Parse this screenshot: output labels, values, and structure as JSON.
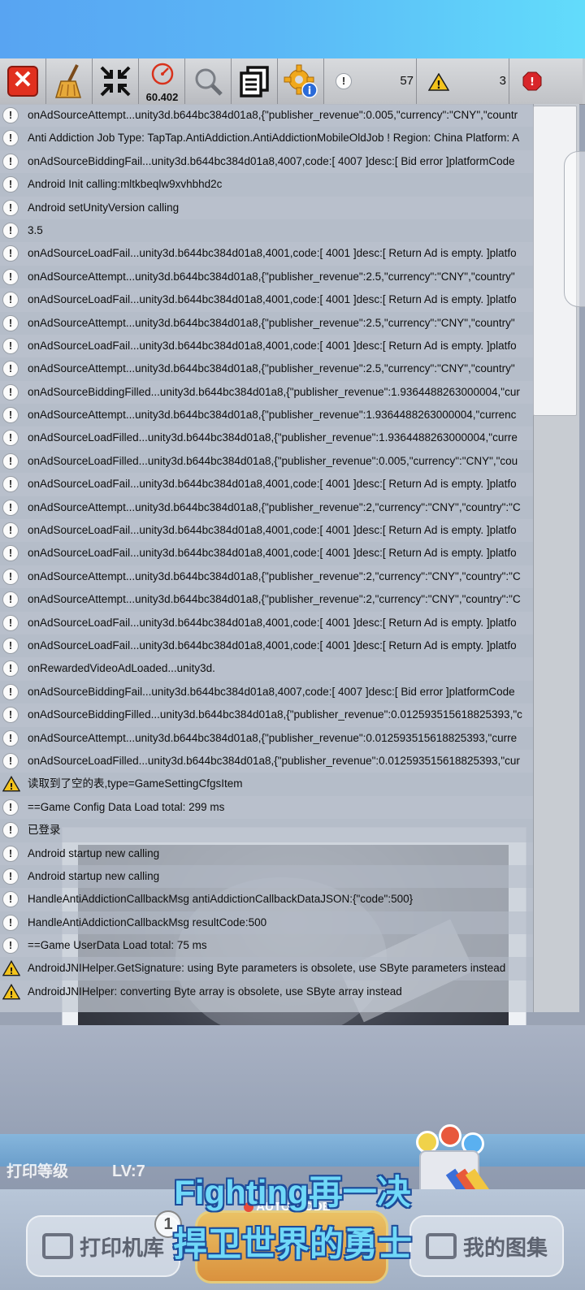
{
  "toolbar": {
    "fps": "60.402",
    "info_count": "57",
    "warning_count": "3"
  },
  "log_entries": [
    {
      "level": "info",
      "text": "onAdSourceAttempt...unity3d.b644bc384d01a8,{\"publisher_revenue\":0.005,\"currency\":\"CNY\",\"countr"
    },
    {
      "level": "info",
      "text": "Anti Addiction Job Type: TapTap.AntiAddiction.AntiAddictionMobileOldJob ! Region: China Platform: A"
    },
    {
      "level": "info",
      "text": "onAdSourceBiddingFail...unity3d.b644bc384d01a8,4007,code:[ 4007 ]desc:[ Bid error ]platformCode"
    },
    {
      "level": "info",
      "text": "Android Init calling:mltkbeqlw9xvhbhd2c"
    },
    {
      "level": "info",
      "text": "Android setUnityVersion calling"
    },
    {
      "level": "info",
      "text": "3.5"
    },
    {
      "level": "info",
      "text": "onAdSourceLoadFail...unity3d.b644bc384d01a8,4001,code:[ 4001 ]desc:[ Return Ad is empty. ]platfo"
    },
    {
      "level": "info",
      "text": "onAdSourceAttempt...unity3d.b644bc384d01a8,{\"publisher_revenue\":2.5,\"currency\":\"CNY\",\"country\""
    },
    {
      "level": "info",
      "text": "onAdSourceLoadFail...unity3d.b644bc384d01a8,4001,code:[ 4001 ]desc:[ Return Ad is empty. ]platfo"
    },
    {
      "level": "info",
      "text": "onAdSourceAttempt...unity3d.b644bc384d01a8,{\"publisher_revenue\":2.5,\"currency\":\"CNY\",\"country\""
    },
    {
      "level": "info",
      "text": "onAdSourceLoadFail...unity3d.b644bc384d01a8,4001,code:[ 4001 ]desc:[ Return Ad is empty. ]platfo"
    },
    {
      "level": "info",
      "text": "onAdSourceAttempt...unity3d.b644bc384d01a8,{\"publisher_revenue\":2.5,\"currency\":\"CNY\",\"country\""
    },
    {
      "level": "info",
      "text": "onAdSourceBiddingFilled...unity3d.b644bc384d01a8,{\"publisher_revenue\":1.9364488263000004,\"cur"
    },
    {
      "level": "info",
      "text": "onAdSourceAttempt...unity3d.b644bc384d01a8,{\"publisher_revenue\":1.9364488263000004,\"currenc"
    },
    {
      "level": "info",
      "text": "onAdSourceLoadFilled...unity3d.b644bc384d01a8,{\"publisher_revenue\":1.9364488263000004,\"curre"
    },
    {
      "level": "info",
      "text": "onAdSourceLoadFilled...unity3d.b644bc384d01a8,{\"publisher_revenue\":0.005,\"currency\":\"CNY\",\"cou"
    },
    {
      "level": "info",
      "text": "onAdSourceLoadFail...unity3d.b644bc384d01a8,4001,code:[ 4001 ]desc:[ Return Ad is empty. ]platfo"
    },
    {
      "level": "info",
      "text": "onAdSourceAttempt...unity3d.b644bc384d01a8,{\"publisher_revenue\":2,\"currency\":\"CNY\",\"country\":\"C"
    },
    {
      "level": "info",
      "text": "onAdSourceLoadFail...unity3d.b644bc384d01a8,4001,code:[ 4001 ]desc:[ Return Ad is empty. ]platfo"
    },
    {
      "level": "info",
      "text": "onAdSourceLoadFail...unity3d.b644bc384d01a8,4001,code:[ 4001 ]desc:[ Return Ad is empty. ]platfo"
    },
    {
      "level": "info",
      "text": "onAdSourceAttempt...unity3d.b644bc384d01a8,{\"publisher_revenue\":2,\"currency\":\"CNY\",\"country\":\"C"
    },
    {
      "level": "info",
      "text": "onAdSourceAttempt...unity3d.b644bc384d01a8,{\"publisher_revenue\":2,\"currency\":\"CNY\",\"country\":\"C"
    },
    {
      "level": "info",
      "text": "onAdSourceLoadFail...unity3d.b644bc384d01a8,4001,code:[ 4001 ]desc:[ Return Ad is empty. ]platfo"
    },
    {
      "level": "info",
      "text": "onAdSourceLoadFail...unity3d.b644bc384d01a8,4001,code:[ 4001 ]desc:[ Return Ad is empty. ]platfo"
    },
    {
      "level": "info",
      "text": "onRewardedVideoAdLoaded...unity3d."
    },
    {
      "level": "info",
      "text": "onAdSourceBiddingFail...unity3d.b644bc384d01a8,4007,code:[ 4007 ]desc:[ Bid error ]platformCode"
    },
    {
      "level": "info",
      "text": "onAdSourceBiddingFilled...unity3d.b644bc384d01a8,{\"publisher_revenue\":0.012593515618825393,\"c"
    },
    {
      "level": "info",
      "text": "onAdSourceAttempt...unity3d.b644bc384d01a8,{\"publisher_revenue\":0.012593515618825393,\"curre"
    },
    {
      "level": "info",
      "text": "onAdSourceLoadFilled...unity3d.b644bc384d01a8,{\"publisher_revenue\":0.012593515618825393,\"cur"
    },
    {
      "level": "warning",
      "text": "读取到了空的表,type=GameSettingCfgsItem"
    },
    {
      "level": "info",
      "text": "==Game Config Data Load total: 299 ms"
    },
    {
      "level": "info",
      "text": "已登录"
    },
    {
      "level": "info",
      "text": "Android startup new calling"
    },
    {
      "level": "info",
      "text": "Android startup new calling"
    },
    {
      "level": "info",
      "text": "HandleAntiAddictionCallbackMsg antiAddictionCallbackDataJSON:{\"code\":500}"
    },
    {
      "level": "info",
      "text": "HandleAntiAddictionCallbackMsg resultCode:500"
    },
    {
      "level": "info",
      "text": "==Game UserData Load total: 75 ms"
    },
    {
      "level": "warning",
      "text": "AndroidJNIHelper.GetSignature: using Byte parameters is obsolete, use SByte parameters instead"
    },
    {
      "level": "warning",
      "text": "AndroidJNIHelper: converting Byte array is obsolete, use SByte array instead"
    }
  ],
  "game": {
    "level_label": "打印等级",
    "level_value": "LV:7",
    "auto_mode": "AUTO MODE",
    "badge_number": "1",
    "printer_library_label": "打印机库",
    "my_gallery_label": "我的图集",
    "subtitle_line1": "Fighting再一决",
    "subtitle_line2": "捍卫世界的勇士"
  },
  "colors": {
    "close_red": "#e1301f",
    "error_red": "#d8262a",
    "warning_yellow": "#f3c31c",
    "subtitle_cyan": "#6fd8f8"
  }
}
